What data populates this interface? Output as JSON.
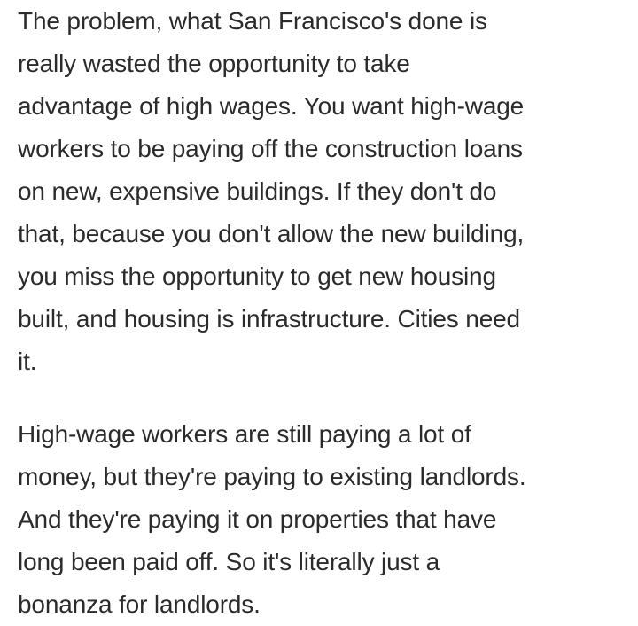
{
  "article": {
    "paragraphs": [
      {
        "lines": [
          "The problem, what San Francisco's done is",
          "really wasted the opportunity to take",
          "advantage of high wages. You want high-wage",
          "workers to be paying off the construction loans",
          "on new, expensive buildings. If they don't do",
          "that, because you don't allow the new building,",
          "you miss the opportunity to get new housing",
          "built, and housing is infrastructure. Cities need",
          "it."
        ]
      },
      {
        "lines": [
          "High-wage workers are still paying a lot of",
          "money, but they're paying to existing landlords.",
          "And they're paying it on properties that have",
          "long been paid off. So it's literally just a",
          "bonanza for landlords."
        ]
      }
    ]
  }
}
